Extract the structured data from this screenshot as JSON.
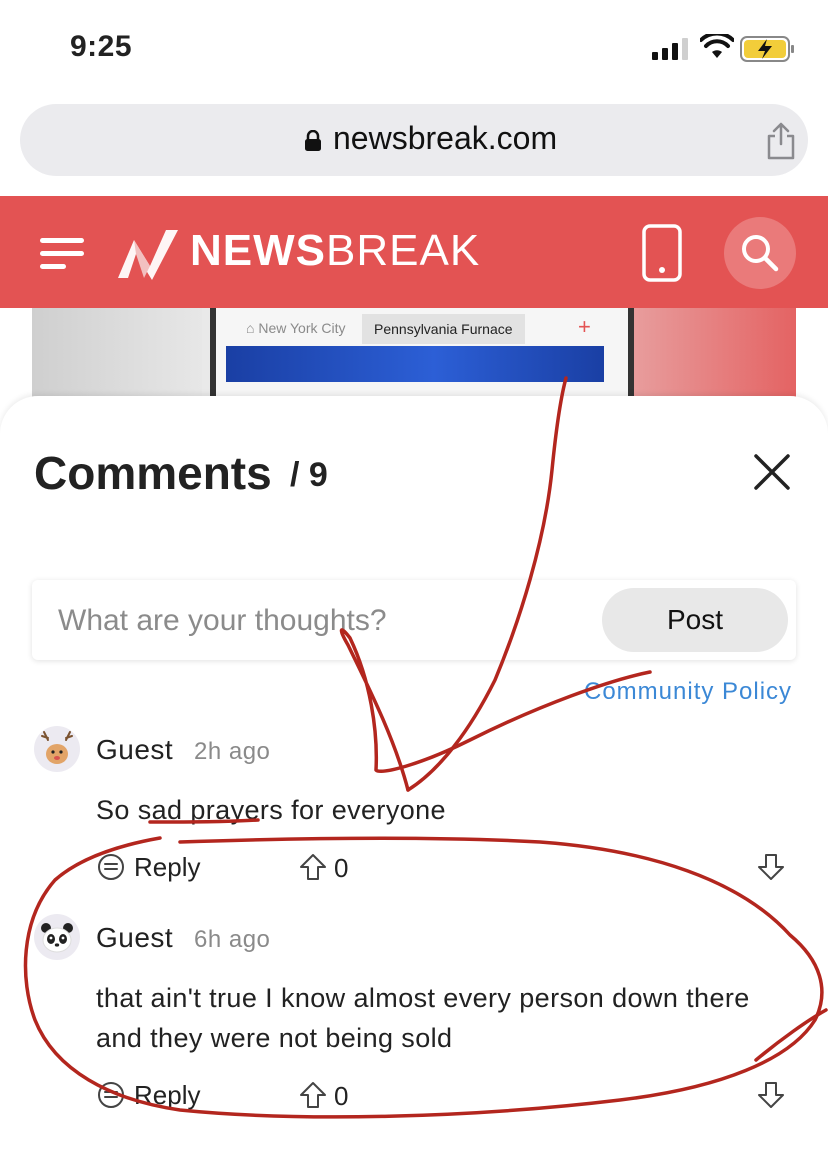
{
  "status_bar": {
    "time": "9:25"
  },
  "browser": {
    "url": "newsbreak.com"
  },
  "header": {
    "brand_bold": "NEWS",
    "brand_light": "BREAK"
  },
  "background_article": {
    "tab_1": "New York City",
    "tab_2": "Pennsylvania Furnace"
  },
  "comments_sheet": {
    "title": "Comments",
    "count": "/ 9",
    "input_placeholder": "What are your thoughts?",
    "post_label": "Post",
    "community_policy": "Community Policy",
    "comments": [
      {
        "author": "Guest",
        "time": "2h ago",
        "text": "So sad prayers for everyone",
        "reply_label": "Reply",
        "upvotes": "0",
        "avatar": "reindeer-avatar"
      },
      {
        "author": "Guest",
        "time": "6h ago",
        "text": "that ain't true I know almost every person down there and they were not being sold",
        "reply_label": "Reply",
        "upvotes": "0",
        "avatar": "panda-avatar"
      }
    ]
  },
  "colors": {
    "brand_red": "#e35353",
    "link_blue": "#3b88d6",
    "annotation_red": "#b3261e"
  }
}
